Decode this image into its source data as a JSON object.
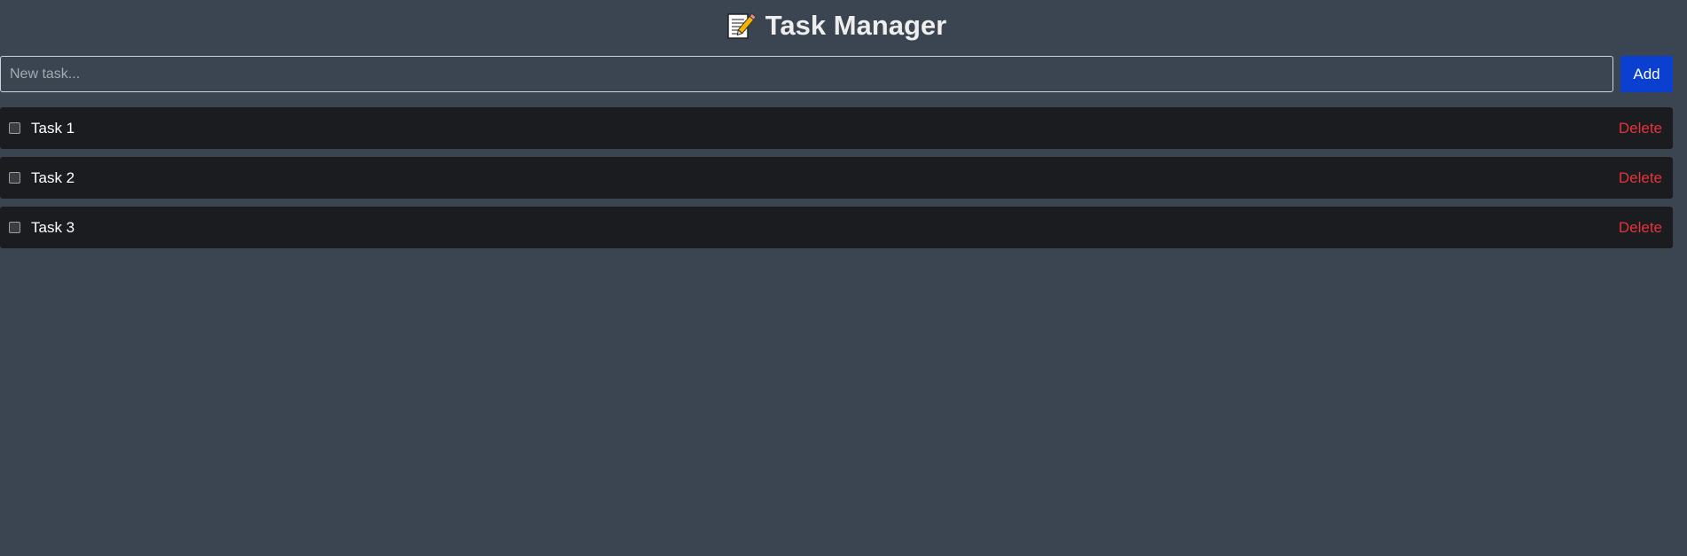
{
  "header": {
    "title": "Task Manager",
    "icon": "memo-icon"
  },
  "new_task": {
    "placeholder": "New task...",
    "value": "",
    "add_label": "Add",
    "add_color": "#0b3fcf"
  },
  "tasks": [
    {
      "label": "Task 1",
      "checked": false,
      "delete_label": "Delete"
    },
    {
      "label": "Task 2",
      "checked": false,
      "delete_label": "Delete"
    },
    {
      "label": "Task 3",
      "checked": false,
      "delete_label": "Delete"
    }
  ],
  "colors": {
    "background": "#3b4552",
    "task_background": "#1a1c1f",
    "delete": "#e8333a"
  }
}
